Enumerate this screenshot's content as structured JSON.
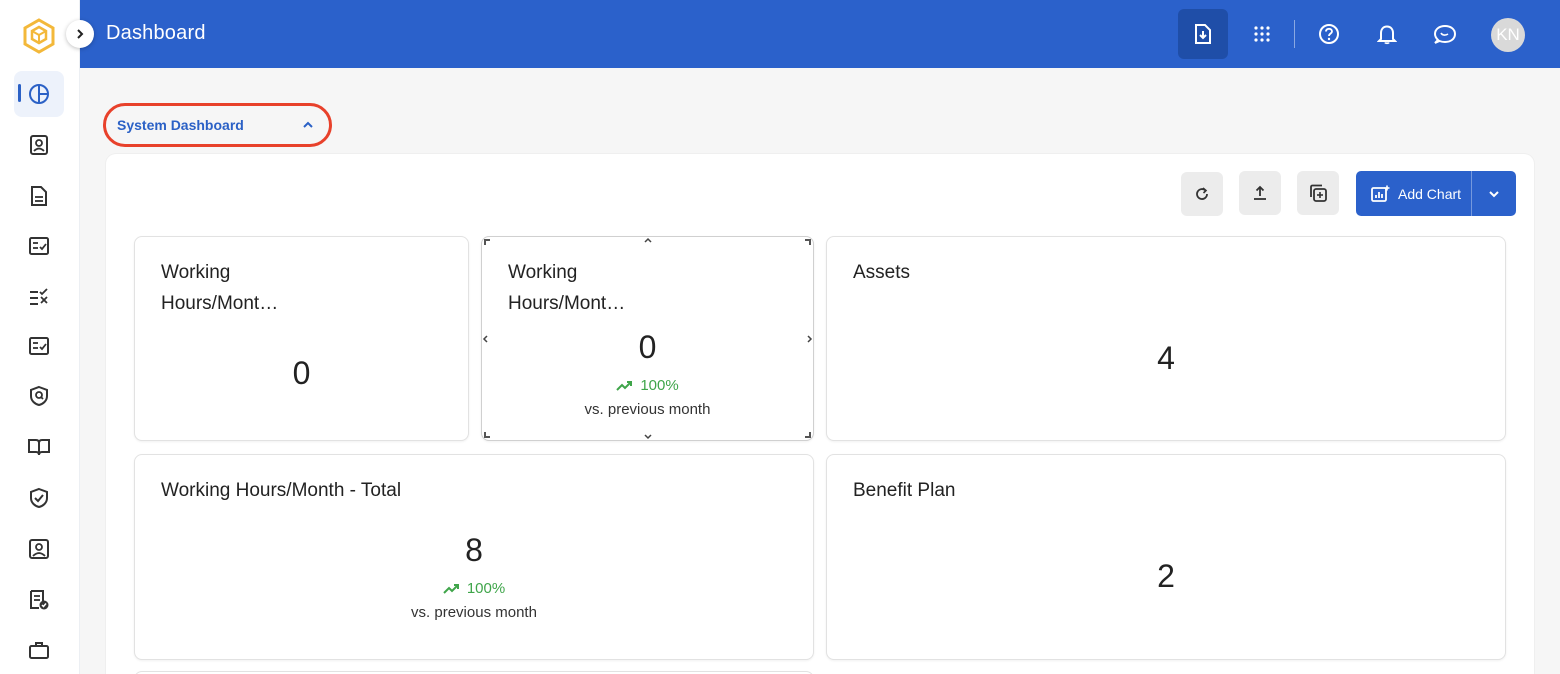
{
  "header": {
    "title": "Dashboard",
    "avatar_initials": "KN",
    "brand_color": "#2b61cb"
  },
  "sidebar": {
    "items": [
      {
        "icon": "pie-chart-icon",
        "active": true
      },
      {
        "icon": "contact-card-icon"
      },
      {
        "icon": "document-icon"
      },
      {
        "icon": "checklist-icon"
      },
      {
        "icon": "list-check-x-icon"
      },
      {
        "icon": "checklist-icon"
      },
      {
        "icon": "shield-search-icon"
      },
      {
        "icon": "open-book-icon"
      },
      {
        "icon": "shield-check-icon"
      },
      {
        "icon": "id-badge-icon"
      },
      {
        "icon": "doc-approved-icon"
      },
      {
        "icon": "briefcase-icon"
      }
    ]
  },
  "dashboard_selector": {
    "label": "System Dashboard"
  },
  "toolbar": {
    "add_chart_label": "Add Chart"
  },
  "cards": [
    {
      "title": "Working Hours/Mont…",
      "title_line1": "Working",
      "title_line2": "Hours/Mont…",
      "value": "0"
    },
    {
      "title_line1": "Working",
      "title_line2": "Hours/Mont…",
      "value": "0",
      "trend": "100%",
      "compare": "vs. previous month"
    },
    {
      "title": "Assets",
      "value": "4"
    },
    {
      "title": "Working Hours/Month - Total",
      "value": "8",
      "trend": "100%",
      "compare": "vs. previous month"
    },
    {
      "title": "Benefit Plan",
      "value": "2"
    }
  ],
  "colors": {
    "highlight_ring": "#e8412b",
    "trend_up": "#3fa54a",
    "content_bg": "#f6f6f6"
  }
}
